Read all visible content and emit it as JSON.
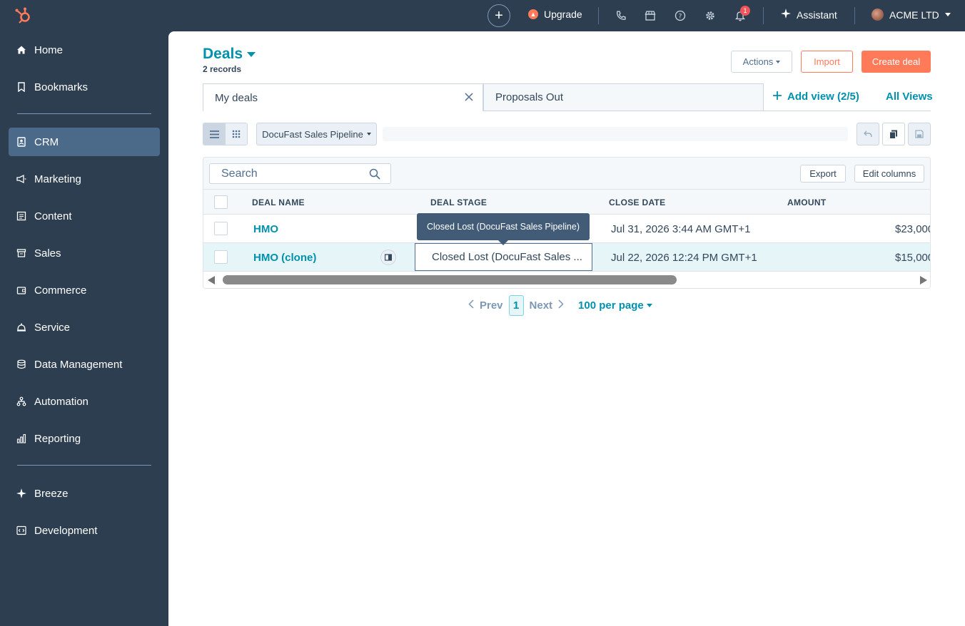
{
  "topbar": {
    "plus_label": "+",
    "upgrade_label": "Upgrade",
    "notification_count": "1",
    "assistant_label": "Assistant",
    "account_name": "ACME LTD"
  },
  "sidebar": {
    "items": [
      {
        "label": "Home",
        "icon": "home-icon"
      },
      {
        "label": "Bookmarks",
        "icon": "bookmark-icon"
      },
      {
        "label": "CRM",
        "icon": "crm-icon"
      },
      {
        "label": "Marketing",
        "icon": "megaphone-icon"
      },
      {
        "label": "Content",
        "icon": "content-icon"
      },
      {
        "label": "Sales",
        "icon": "sales-icon"
      },
      {
        "label": "Commerce",
        "icon": "wallet-icon"
      },
      {
        "label": "Service",
        "icon": "bell-service-icon"
      },
      {
        "label": "Data Management",
        "icon": "database-icon"
      },
      {
        "label": "Automation",
        "icon": "automation-icon"
      },
      {
        "label": "Reporting",
        "icon": "bar-chart-icon"
      },
      {
        "label": "Breeze",
        "icon": "sparkle-icon"
      },
      {
        "label": "Development",
        "icon": "code-icon"
      }
    ]
  },
  "header": {
    "title": "Deals",
    "records": "2 records",
    "actions_label": "Actions",
    "import_label": "Import",
    "create_label": "Create deal"
  },
  "tabs": [
    {
      "label": "My deals"
    },
    {
      "label": "Proposals Out"
    }
  ],
  "add_view_label": "Add view (2/5)",
  "all_views_label": "All Views",
  "pipeline_label": "DocuFast Sales Pipeline",
  "table": {
    "search_placeholder": "Search",
    "export_label": "Export",
    "edit_columns_label": "Edit columns",
    "columns": [
      "DEAL NAME",
      "DEAL STAGE",
      "CLOSE DATE",
      "AMOUNT"
    ],
    "rows": [
      {
        "name": "HMO",
        "stage": "",
        "close_date": "Jul 31, 2026 3:44 AM GMT+1",
        "amount": "$23,000"
      },
      {
        "name": "HMO (clone)",
        "stage": "Closed Lost (DocuFast Sales ...",
        "close_date": "Jul 22, 2026 12:24 PM GMT+1",
        "amount": "$15,000"
      }
    ]
  },
  "tooltip": "Closed Lost (DocuFast Sales Pipeline)",
  "pagination": {
    "prev_label": "Prev",
    "current_page": "1",
    "next_label": "Next",
    "per_page_label": "100 per page"
  },
  "colors": {
    "accent": "#0091ae",
    "primary_button": "#ff7a59",
    "sidebar_bg": "#2d3e50"
  }
}
